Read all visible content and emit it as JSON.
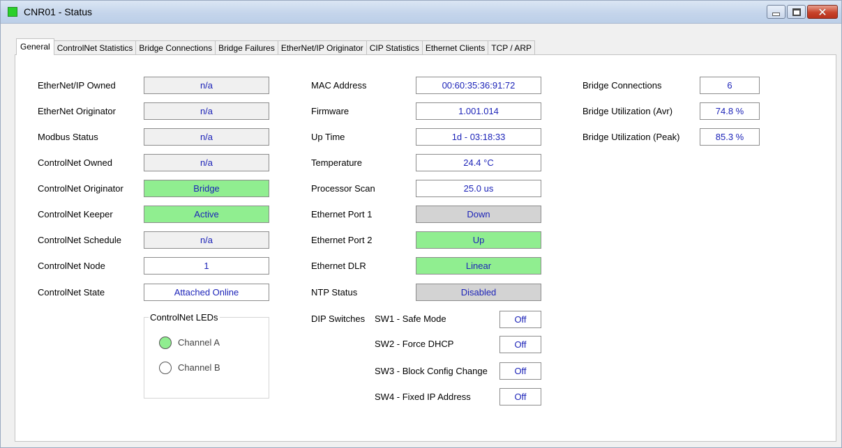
{
  "window": {
    "title": "CNR01 - Status",
    "app_icon_color": "#2bd02b",
    "close_glyph": "✕"
  },
  "tabs": [
    {
      "label": "General",
      "active": true
    },
    {
      "label": "ControlNet Statistics"
    },
    {
      "label": "Bridge Connections"
    },
    {
      "label": "Bridge Failures"
    },
    {
      "label": "EtherNet/IP Originator"
    },
    {
      "label": "CIP Statistics"
    },
    {
      "label": "Ethernet Clients"
    },
    {
      "label": "TCP / ARP"
    }
  ],
  "left_fields": [
    {
      "label": "EtherNet/IP Owned",
      "value": "n/a",
      "state": "gray"
    },
    {
      "label": "EtherNet Originator",
      "value": "n/a",
      "state": "gray"
    },
    {
      "label": "Modbus Status",
      "value": "n/a",
      "state": "gray"
    },
    {
      "label": "ControlNet Owned",
      "value": "n/a",
      "state": "gray"
    },
    {
      "label": "ControlNet Originator",
      "value": "Bridge",
      "state": "green"
    },
    {
      "label": "ControlNet Keeper",
      "value": "Active",
      "state": "green"
    },
    {
      "label": "ControlNet Schedule",
      "value": "n/a",
      "state": "gray"
    },
    {
      "label": "ControlNet Node",
      "value": "1",
      "state": "white"
    },
    {
      "label": "ControlNet State",
      "value": "Attached Online",
      "state": "white"
    }
  ],
  "mid_fields": [
    {
      "label": "MAC Address",
      "value": "00:60:35:36:91:72",
      "state": "white"
    },
    {
      "label": "Firmware",
      "value": "1.001.014",
      "state": "white"
    },
    {
      "label": "Up Time",
      "value": "1d - 03:18:33",
      "state": "white"
    },
    {
      "label": "Temperature",
      "value": "24.4 °C",
      "state": "white"
    },
    {
      "label": "Processor Scan",
      "value": "25.0 us",
      "state": "white"
    },
    {
      "label": "Ethernet Port 1",
      "value": "Down",
      "state": "dgray"
    },
    {
      "label": "Ethernet Port 2",
      "value": "Up",
      "state": "green"
    },
    {
      "label": "Ethernet DLR",
      "value": "Linear",
      "state": "green"
    },
    {
      "label": "NTP Status",
      "value": "Disabled",
      "state": "dgray"
    }
  ],
  "right_fields": [
    {
      "label": "Bridge Connections",
      "value": "6"
    },
    {
      "label": "Bridge Utilization (Avr)",
      "value": "74.8 %"
    },
    {
      "label": "Bridge Utilization (Peak)",
      "value": "85.3 %"
    }
  ],
  "dip": {
    "title": "DIP Switches",
    "switches": [
      {
        "label": "SW1 - Safe Mode",
        "value": "Off"
      },
      {
        "label": "SW2 - Force DHCP",
        "value": "Off"
      },
      {
        "label": "SW3 - Block Config Change",
        "value": "Off"
      },
      {
        "label": "SW4 - Fixed IP Address",
        "value": "Off"
      }
    ]
  },
  "leds": {
    "title": "ControlNet LEDs",
    "channels": [
      {
        "label": "Channel A",
        "color": "#90ee90"
      },
      {
        "label": "Channel B",
        "color": "#ffffff"
      }
    ]
  }
}
